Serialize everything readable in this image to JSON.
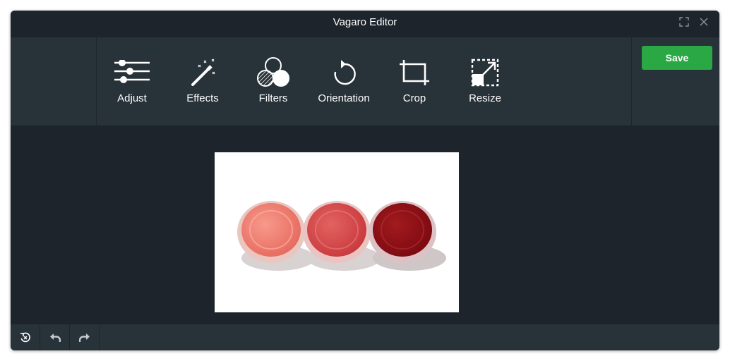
{
  "window": {
    "title": "Vagaro Editor",
    "maximize_icon": "expand-icon",
    "close_icon": "close-icon"
  },
  "toolbar": {
    "tools": [
      {
        "label": "Adjust",
        "icon": "sliders-icon"
      },
      {
        "label": "Effects",
        "icon": "magic-wand-icon"
      },
      {
        "label": "Filters",
        "icon": "filter-circles-icon"
      },
      {
        "label": "Orientation",
        "icon": "rotate-icon"
      },
      {
        "label": "Crop",
        "icon": "crop-icon"
      },
      {
        "label": "Resize",
        "icon": "resize-icon"
      }
    ],
    "save_label": "Save"
  },
  "canvas": {
    "image_subject": "three lip balm pots in coral, red and dark red"
  },
  "footer": {
    "buttons": [
      {
        "icon": "reset-icon"
      },
      {
        "icon": "undo-icon"
      },
      {
        "icon": "redo-icon"
      }
    ]
  },
  "colors": {
    "window_bg": "#1d242b",
    "toolbar_bg": "#283239",
    "save_button": "#29a844",
    "text": "#ffffff"
  }
}
